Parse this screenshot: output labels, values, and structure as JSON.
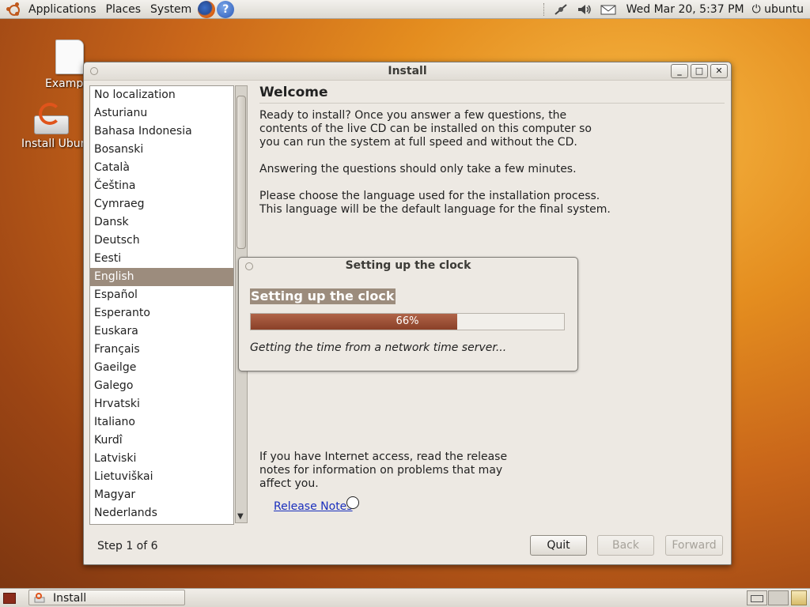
{
  "top_panel": {
    "menus": [
      "Applications",
      "Places",
      "System"
    ],
    "clock": "Wed Mar 20,  5:37 PM",
    "user": "ubuntu"
  },
  "desktop": {
    "icons": [
      {
        "label": "Examples",
        "icon": "document-icon"
      },
      {
        "label": "Install Ubuntu",
        "icon": "installer-icon"
      }
    ]
  },
  "window": {
    "title": "Install",
    "controls": [
      "minimize",
      "maximize",
      "close"
    ],
    "languages": [
      "No localization",
      "Asturianu",
      "Bahasa Indonesia",
      "Bosanski",
      "Català",
      "Čeština",
      "Cymraeg",
      "Dansk",
      "Deutsch",
      "Eesti",
      "English",
      "Español",
      "Esperanto",
      "Euskara",
      "Français",
      "Gaeilge",
      "Galego",
      "Hrvatski",
      "Italiano",
      "Kurdî",
      "Latviski",
      "Lietuviškai",
      "Magyar",
      "Nederlands"
    ],
    "selected_language": "English",
    "welcome_title": "Welcome",
    "intro_lines": [
      "Ready to install? Once you answer a few questions, the",
      "contents of the live CD can be installed on this computer so",
      "you can run the system at full speed and without the CD."
    ],
    "answering": "Answering the questions should only take a few minutes.",
    "choose_lines": [
      "Please choose the language used for the installation process.",
      "This language will be the default language for the final system."
    ],
    "internet_lines": [
      "If you have Internet access, read the release",
      "notes for information on problems that may",
      "affect you."
    ],
    "release_notes": "Release Notes",
    "step": "Step 1 of 6",
    "buttons": {
      "quit": "Quit",
      "back": "Back",
      "forward": "Forward"
    }
  },
  "dialog": {
    "title": "Setting up the clock",
    "heading": "Setting up the clock",
    "progress": 0.66,
    "progress_label": "66%",
    "status": "Getting the time from a network time server..."
  },
  "bottom_panel": {
    "task": "Install"
  }
}
